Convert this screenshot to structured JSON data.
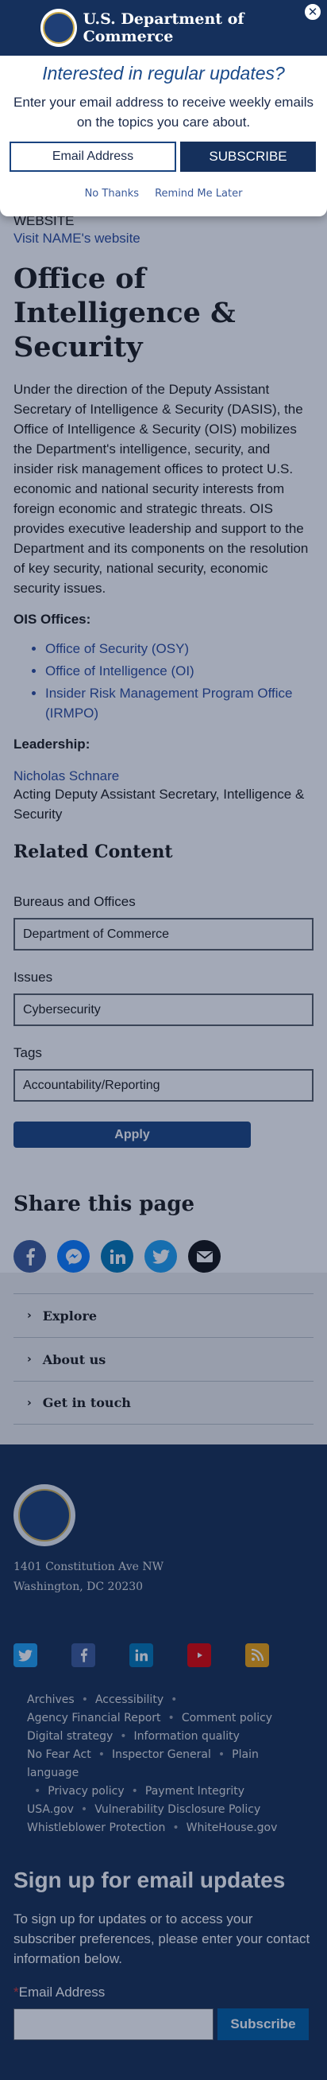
{
  "modal": {
    "agency_name": "U.S. Department of Commerce",
    "heading": "Interested in regular updates?",
    "description": "Enter your email address to receive weekly emails on the topics you care about.",
    "email_placeholder": "Email Address",
    "subscribe_label": "SUBSCRIBE",
    "no_thanks_label": "No Thanks",
    "remind_label": "Remind Me Later",
    "close_glyph": "✕"
  },
  "page": {
    "website_label": "WEBSITE",
    "website_link": "Visit NAME's website",
    "title": "Office of Intelligence & Security",
    "intro": "Under the direction of the Deputy Assistant Secretary of Intelligence & Security (DASIS), the Office of Intelligence & Security (OIS) mobilizes the Department's intelligence, security, and insider risk management offices to protect U.S. economic and national security interests from foreign economic and strategic threats. OIS provides executive leadership and support to the Department and its components on the resolution of key security, national security, economic security issues.",
    "offices_label": "OIS Offices:",
    "offices": [
      "Office of Security (OSY)",
      "Office of Intelligence (OI)",
      "Insider Risk Management Program Office (IRMPO)"
    ],
    "leadership_label": "Leadership:",
    "leader_name": "Nicholas Schnare",
    "leader_title": "Acting Deputy Assistant Secretary, Intelligence & Security"
  },
  "related": {
    "heading": "Related Content",
    "bureaus_label": "Bureaus and Offices",
    "bureaus_value": "Department of Commerce",
    "issues_label": "Issues",
    "issues_value": "Cybersecurity",
    "tags_label": "Tags",
    "tags_value": "Accountability/Reporting",
    "apply_label": "Apply"
  },
  "share": {
    "heading": "Share this page",
    "icons": [
      "facebook-icon",
      "messenger-icon",
      "linkedin-icon",
      "twitter-icon",
      "email-icon"
    ]
  },
  "accordion": {
    "items": [
      "Explore",
      "About us",
      "Get in touch"
    ]
  },
  "footer": {
    "address_line1": "1401 Constitution Ave NW",
    "address_line2": "Washington, DC 20230",
    "social_icons": [
      "twitter-icon",
      "facebook-icon",
      "linkedin-icon",
      "youtube-icon",
      "rss-icon"
    ],
    "links": [
      "Archives",
      "Accessibility",
      "Agency Financial Report",
      "Comment policy",
      "Digital strategy",
      "Information quality",
      "No Fear Act",
      "Inspector General",
      "Plain language",
      "Privacy policy",
      "Payment Integrity",
      "USA.gov",
      "Vulnerability Disclosure Policy",
      "Whistleblower Protection",
      "WhiteHouse.gov"
    ],
    "signup_heading": "Sign up for email updates",
    "signup_text": "To sign up for updates or to access your subscriber preferences, please enter your contact information below.",
    "required_mark": "*",
    "email_label": "Email Address",
    "subscribe_label": "Subscribe"
  },
  "colors": {
    "navy": "#15305c",
    "link": "#2b4b9c",
    "footer_bg": "#162e51",
    "apply": "#1a4480",
    "subscribe": "#005ea2"
  }
}
